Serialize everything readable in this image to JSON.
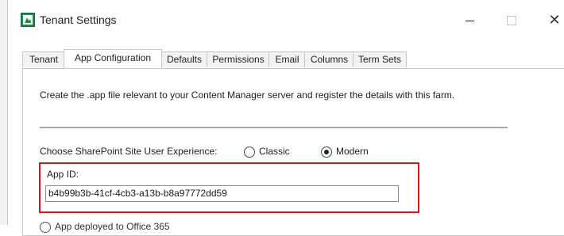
{
  "window": {
    "title": "Tenant Settings"
  },
  "tabs": [
    {
      "label": "Tenant",
      "active": false
    },
    {
      "label": "App Configuration",
      "active": true
    },
    {
      "label": "Defaults",
      "active": false
    },
    {
      "label": "Permissions",
      "active": false
    },
    {
      "label": "Email",
      "active": false
    },
    {
      "label": "Columns",
      "active": false
    },
    {
      "label": "Term Sets",
      "active": false
    }
  ],
  "app_config": {
    "intro_text": "Create the .app file relevant to your Content Manager server and register the details with this farm.",
    "experience_label": "Choose SharePoint Site User Experience:",
    "experience_options": [
      {
        "label": "Classic",
        "selected": false
      },
      {
        "label": "Modern",
        "selected": true
      }
    ],
    "app_id_label": "App ID:",
    "app_id_value": "b4b99b3b-41cf-4cb3-a13b-b8a97772dd59",
    "partial_option_label": "App deployed to Office 365"
  },
  "colors": {
    "highlight": "#d6171a",
    "icon_green": "#1f8a4c"
  }
}
